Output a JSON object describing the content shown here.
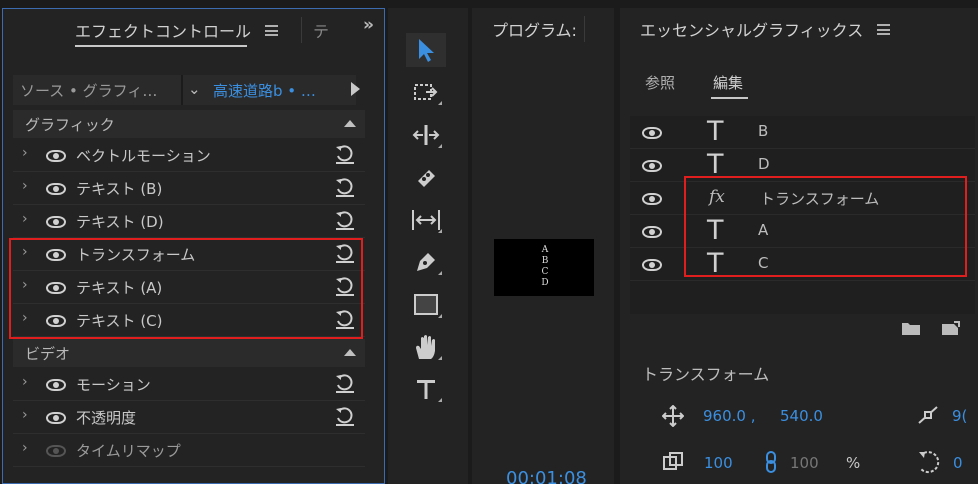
{
  "effect_controls": {
    "title": "エフェクトコントロール",
    "second_tab": "テ",
    "overflow": "»",
    "source_label": "ソース • グラフィ…",
    "clip_label": "高速道路b • …",
    "sections": [
      {
        "label": "グラフィック",
        "rows": [
          {
            "name": "ベクトルモーション"
          },
          {
            "name": "テキスト (B)"
          },
          {
            "name": "テキスト (D)"
          },
          {
            "name": "トランスフォーム"
          },
          {
            "name": "テキスト (A)"
          },
          {
            "name": "テキスト (C)"
          }
        ]
      },
      {
        "label": "ビデオ",
        "rows": [
          {
            "name": "モーション"
          },
          {
            "name": "不透明度"
          },
          {
            "name": "タイムリマップ"
          }
        ]
      }
    ]
  },
  "tools": [
    "selection-tool",
    "track-select-tool",
    "ripple-edit-tool",
    "razor-tool",
    "slip-tool",
    "pen-tool",
    "rectangle-tool",
    "hand-tool",
    "type-tool"
  ],
  "program": {
    "title": "プログラム:",
    "preview_letters": [
      "A",
      "B",
      "C",
      "D"
    ],
    "timecode": "00:01:08"
  },
  "essential_graphics": {
    "title": "エッセンシャルグラフィックス",
    "tabs": {
      "browse": "参照",
      "edit": "編集"
    },
    "layers": [
      {
        "type": "text",
        "icon": "T",
        "name": "B"
      },
      {
        "type": "text",
        "icon": "T",
        "name": "D"
      },
      {
        "type": "fx",
        "icon": "fx",
        "name": "トランスフォーム"
      },
      {
        "type": "text",
        "icon": "T",
        "name": "A"
      },
      {
        "type": "text",
        "icon": "T",
        "name": "C"
      }
    ],
    "section_title": "トランスフォーム",
    "position_x": "960.0 ,",
    "position_y": "540.0",
    "anchor_val": "9(",
    "scale_val": "100",
    "scale_locked_val": "100",
    "percent": "%",
    "rotation_val": "0"
  },
  "colors": {
    "accent": "#3b8fe0",
    "highlight": "#e01e1e",
    "panel": "#232323"
  }
}
